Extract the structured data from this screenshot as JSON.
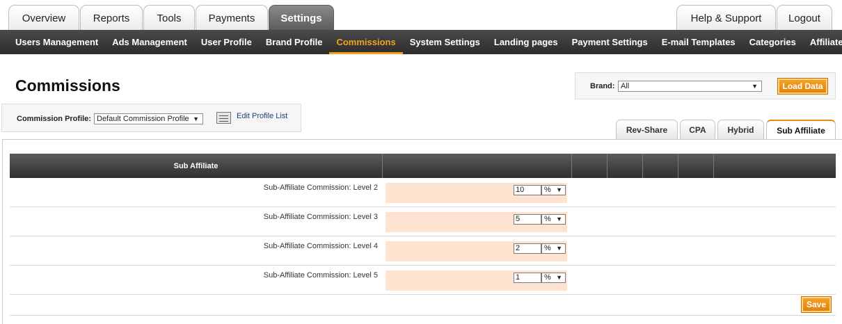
{
  "top_tabs": [
    "Overview",
    "Reports",
    "Tools",
    "Payments",
    "Settings"
  ],
  "top_tabs_right": [
    "Help & Support",
    "Logout"
  ],
  "active_top_tab": "Settings",
  "sub_nav": [
    "Users Management",
    "Ads Management",
    "User Profile",
    "Brand Profile",
    "Commissions",
    "System Settings",
    "Landing pages",
    "Payment Settings",
    "E-mail Templates",
    "Categories",
    "Affiliate Groups"
  ],
  "active_sub_nav": "Commissions",
  "page_title": "Commissions",
  "brand": {
    "label": "Brand:",
    "value": "All",
    "button": "Load Data"
  },
  "profile": {
    "label": "Commission Profile:",
    "value": "Default Commission Profile",
    "edit_link": "Edit Profile List",
    "icon": "table-list-icon"
  },
  "commission_tabs": [
    "Rev-Share",
    "CPA",
    "Hybrid",
    "Sub Affiliate"
  ],
  "active_commission_tab": "Sub Affiliate",
  "table": {
    "header": "Sub Affiliate",
    "rows": [
      {
        "label": "Sub-Affiliate Commission: Level 2",
        "value": "10",
        "unit": "%"
      },
      {
        "label": "Sub-Affiliate Commission: Level 3",
        "value": "5",
        "unit": "%"
      },
      {
        "label": "Sub-Affiliate Commission: Level 4",
        "value": "2",
        "unit": "%"
      },
      {
        "label": "Sub-Affiliate Commission: Level 5",
        "value": "1",
        "unit": "%"
      }
    ]
  },
  "save_label": "Save",
  "colors": {
    "accent": "#f4a21a",
    "nav_bg": "#2c2c2c",
    "row_fill": "#fde3d0"
  }
}
